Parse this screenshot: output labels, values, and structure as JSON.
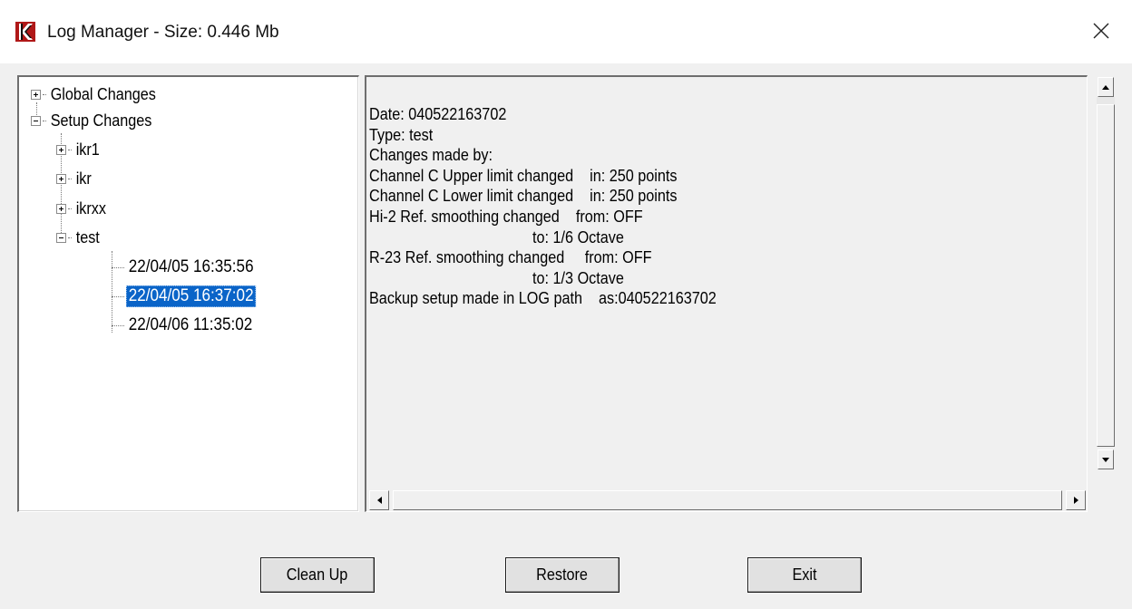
{
  "window": {
    "title": "Log Manager - Size: 0.446 Mb",
    "logo_icon": "kk-logo-icon",
    "close_icon": "close-icon",
    "colors": {
      "logo_red": "#c81e1e",
      "selection": "#0a64c8"
    }
  },
  "tree": {
    "nodes": [
      {
        "label": "Global Changes",
        "state": "collapsed"
      },
      {
        "label": "Setup Changes",
        "state": "expanded",
        "children": [
          {
            "label": "ikr1",
            "state": "collapsed"
          },
          {
            "label": "ikr",
            "state": "collapsed"
          },
          {
            "label": "ikrxx",
            "state": "collapsed"
          },
          {
            "label": "test",
            "state": "expanded",
            "children": [
              {
                "label": "22/04/05 16:35:56"
              },
              {
                "label": "22/04/05 16:37:02",
                "selected": true
              },
              {
                "label": "22/04/06 11:35:02"
              }
            ]
          }
        ]
      }
    ]
  },
  "details": {
    "lines": [
      "Date: 040522163702",
      "Type: test",
      "Changes made by:",
      "Channel C Upper limit changed    in: 250 points",
      "Channel C Lower limit changed    in: 250 points",
      "Hi-2 Ref. smoothing changed    from: OFF",
      "                                        to: 1/6 Octave",
      "R-23 Ref. smoothing changed     from: OFF",
      "                                        to: 1/3 Octave",
      "Backup setup made in LOG path    as:040522163702"
    ]
  },
  "buttons": {
    "clean_up": "Clean Up",
    "restore": "Restore",
    "exit": "Exit"
  }
}
